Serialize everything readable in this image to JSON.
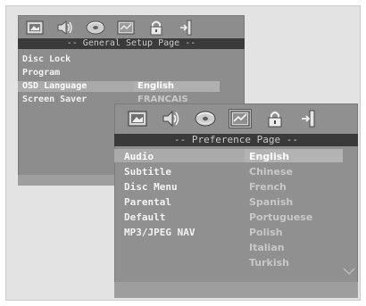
{
  "colors": {
    "frame": "#e3e3e3",
    "osd_bg": "#8d8d8d",
    "title_bg": "#3a3a3a",
    "highlight": "#aaaaaa",
    "text": "#f3f3f3",
    "option_text": "#c8c8c8"
  },
  "back_window": {
    "icons": [
      "picture-icon",
      "audio-speaker-icon",
      "disc-icon",
      "preference-icon",
      "lock-icon",
      "exit-icon"
    ],
    "title": "-- General Setup Page --",
    "items": [
      "Disc Lock",
      "Program",
      "OSD Language",
      "Screen Saver"
    ],
    "options": [
      "English",
      "FRANCAIS"
    ]
  },
  "front_window": {
    "icons": [
      "picture-icon",
      "audio-speaker-icon",
      "disc-icon",
      "preference-icon",
      "lock-icon",
      "exit-icon"
    ],
    "title": "-- Preference Page --",
    "items": [
      "Audio",
      "Subtitle",
      "Disc Menu",
      "Parental",
      "Default",
      "MP3/JPEG NAV"
    ],
    "options": [
      "English",
      "Chinese",
      "French",
      "Spanish",
      "Portuguese",
      "Polish",
      "Italian",
      "Turkish"
    ]
  }
}
